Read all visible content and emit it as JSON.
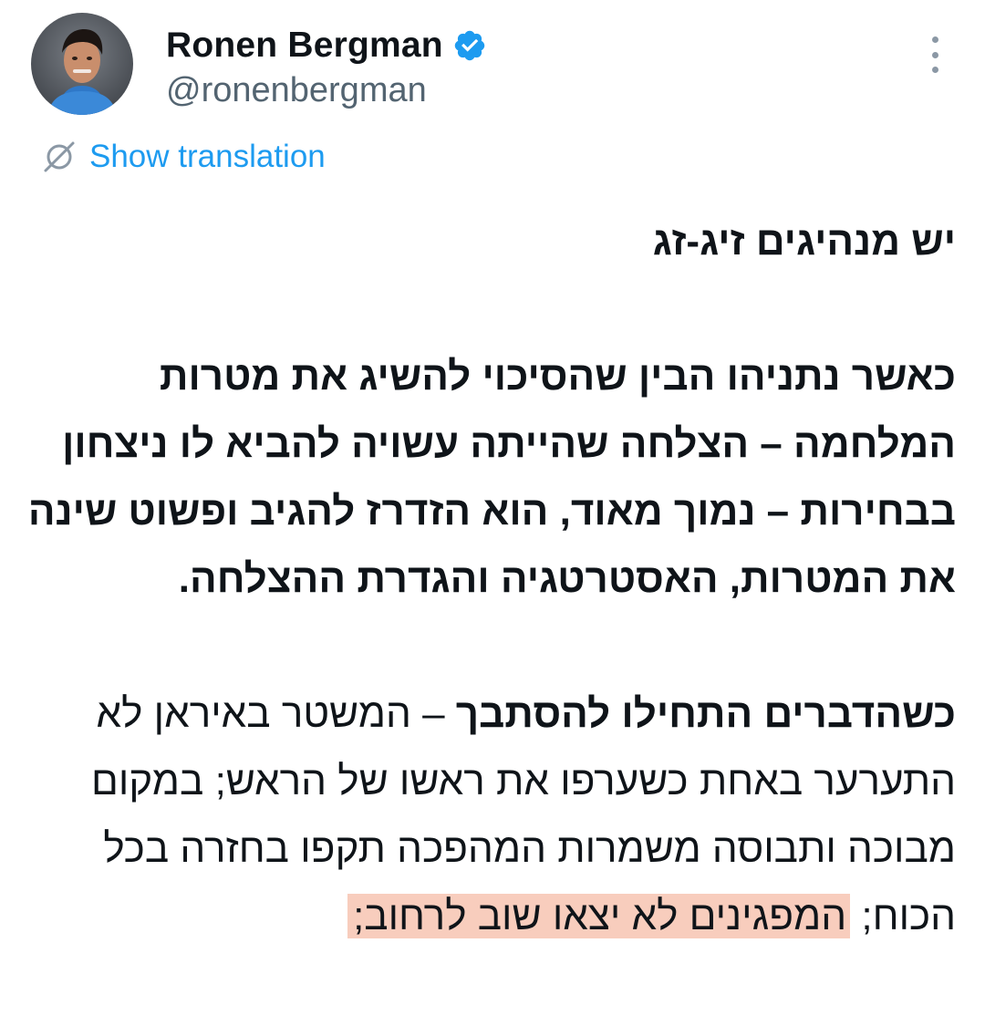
{
  "author": {
    "display_name": "Ronen Bergman",
    "handle": "@ronenbergman",
    "verified": true
  },
  "actions": {
    "show_translation": "Show translation"
  },
  "tweet": {
    "line1": "יש מנהיגים זיג-זג",
    "paragraph2": "כאשר נתניהו הבין שהסיכוי להשיג את מטרות המלחמה – הצלחה שהייתה עשויה להביא לו ניצחון בבחירות – נמוך מאוד, הוא הזדרז להגיב ופשוט שינה את המטרות, האסטרטגיה והגדרת ההצלחה.",
    "paragraph3_bold": "כשהדברים התחילו להסתבך",
    "paragraph3_rest": " – המשטר באיראן לא התערער באחת כשערפו את ראשו של הראש; במקום מבוכה ותבוסה משמרות המהפכה תקפו בחזרה בכל הכוח; ",
    "paragraph3_highlight": "המפגינים לא יצאו שוב לרחוב;"
  },
  "colors": {
    "link": "#1d9bf0",
    "verified": "#1d9bf0",
    "highlight": "#f8cdbd",
    "secondary_text": "#536471"
  },
  "icons": {
    "more": "more-vertical-icon",
    "translate": "translate-icon",
    "verified": "verified-badge-icon"
  }
}
